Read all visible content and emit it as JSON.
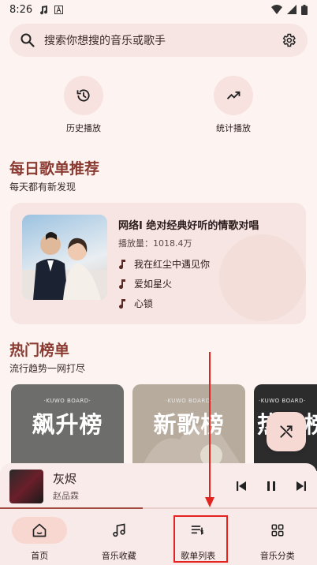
{
  "status_bar": {
    "time": "8:26"
  },
  "search": {
    "placeholder": "搜索你想搜的音乐或歌手"
  },
  "quick_actions": [
    {
      "label": "历史播放",
      "icon": "history-icon"
    },
    {
      "label": "统计播放",
      "icon": "trending-icon"
    }
  ],
  "daily": {
    "title": "每日歌单推荐",
    "subtitle": "每天都有新发现",
    "playlist": {
      "title": "网络I 绝对经典好听的情歌对唱",
      "plays": "播放量：1018.4万",
      "songs": [
        "我在红尘中遇见你",
        "爱如星火",
        "心锁"
      ]
    }
  },
  "charts": {
    "title": "热门榜单",
    "subtitle": "流行趋势一网打尽",
    "cards": [
      {
        "brand": "·KUWO BOARD·",
        "name": "飙升榜",
        "bg": "#6d6d6b"
      },
      {
        "brand": "·KUWO BOARD·",
        "name": "新歌榜",
        "bg": "#b7ab9d"
      },
      {
        "brand": "·KUWO BOARD·",
        "name": "热歌榜",
        "bg": "#2c2c2c"
      }
    ]
  },
  "now_playing": {
    "title": "灰烬",
    "artist": "赵品霖",
    "progress": 0.45
  },
  "nav": {
    "items": [
      {
        "label": "首页",
        "icon": "home-icon",
        "active": true
      },
      {
        "label": "音乐收藏",
        "icon": "music-collection-icon",
        "active": false
      },
      {
        "label": "歌单列表",
        "icon": "playlist-icon",
        "active": false
      },
      {
        "label": "音乐分类",
        "icon": "category-grid-icon",
        "active": false
      }
    ]
  },
  "colors": {
    "accent": "#8a3b32",
    "annotation": "#e3231f",
    "background": "#fdf3f1"
  }
}
